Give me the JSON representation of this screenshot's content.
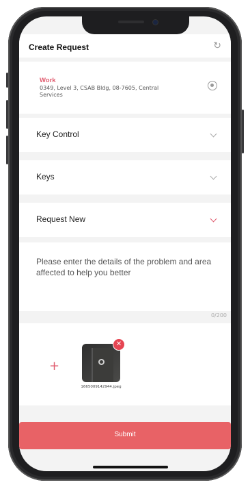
{
  "header": {
    "title": "Create Request",
    "refresh_icon": "refresh-icon"
  },
  "location": {
    "label": "Work",
    "address": "0349, Level 3, CSAB Bldg, 08-7605, Central Services",
    "icon": "target-icon"
  },
  "dropdowns": [
    {
      "label": "Key Control"
    },
    {
      "label": "Keys"
    },
    {
      "label": "Request New"
    }
  ],
  "description": {
    "placeholder": "Please enter the details of the problem and area affected to help you better",
    "counter": "0/200"
  },
  "attachments": {
    "add_icon": "+",
    "items": [
      {
        "filename": "1665009142944.jpeg",
        "remove_icon": "✕"
      }
    ]
  },
  "actions": {
    "submit_label": "Submit"
  },
  "colors": {
    "accent": "#e05b6e",
    "submit_bg": "#e86266",
    "remove": "#e64552"
  }
}
